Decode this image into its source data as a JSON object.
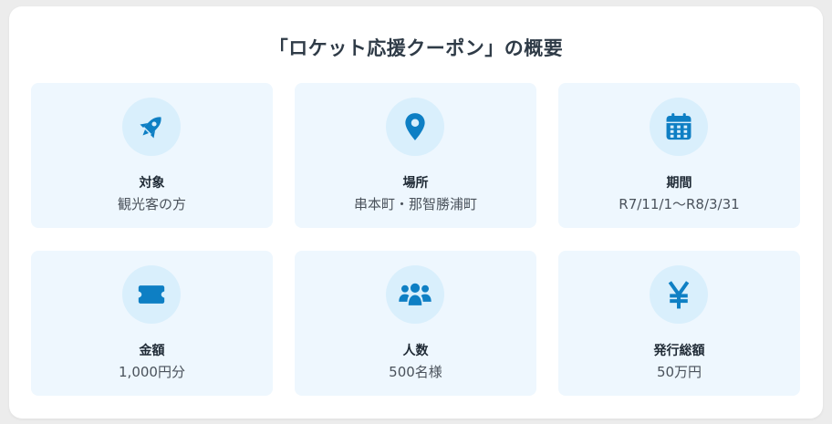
{
  "title": "「ロケット応援クーポン」の概要",
  "accent_color": "#0e7fc4",
  "cards": [
    {
      "icon": "rocket-icon",
      "label": "対象",
      "value": "観光客の方"
    },
    {
      "icon": "map-pin-icon",
      "label": "場所",
      "value": "串本町・那智勝浦町"
    },
    {
      "icon": "calendar-icon",
      "label": "期間",
      "value": "R7/11/1〜R8/3/31"
    },
    {
      "icon": "ticket-icon",
      "label": "金額",
      "value": "1,000円分"
    },
    {
      "icon": "users-icon",
      "label": "人数",
      "value": "500名様"
    },
    {
      "icon": "yen-icon",
      "label": "発行総額",
      "value": "50万円"
    }
  ]
}
